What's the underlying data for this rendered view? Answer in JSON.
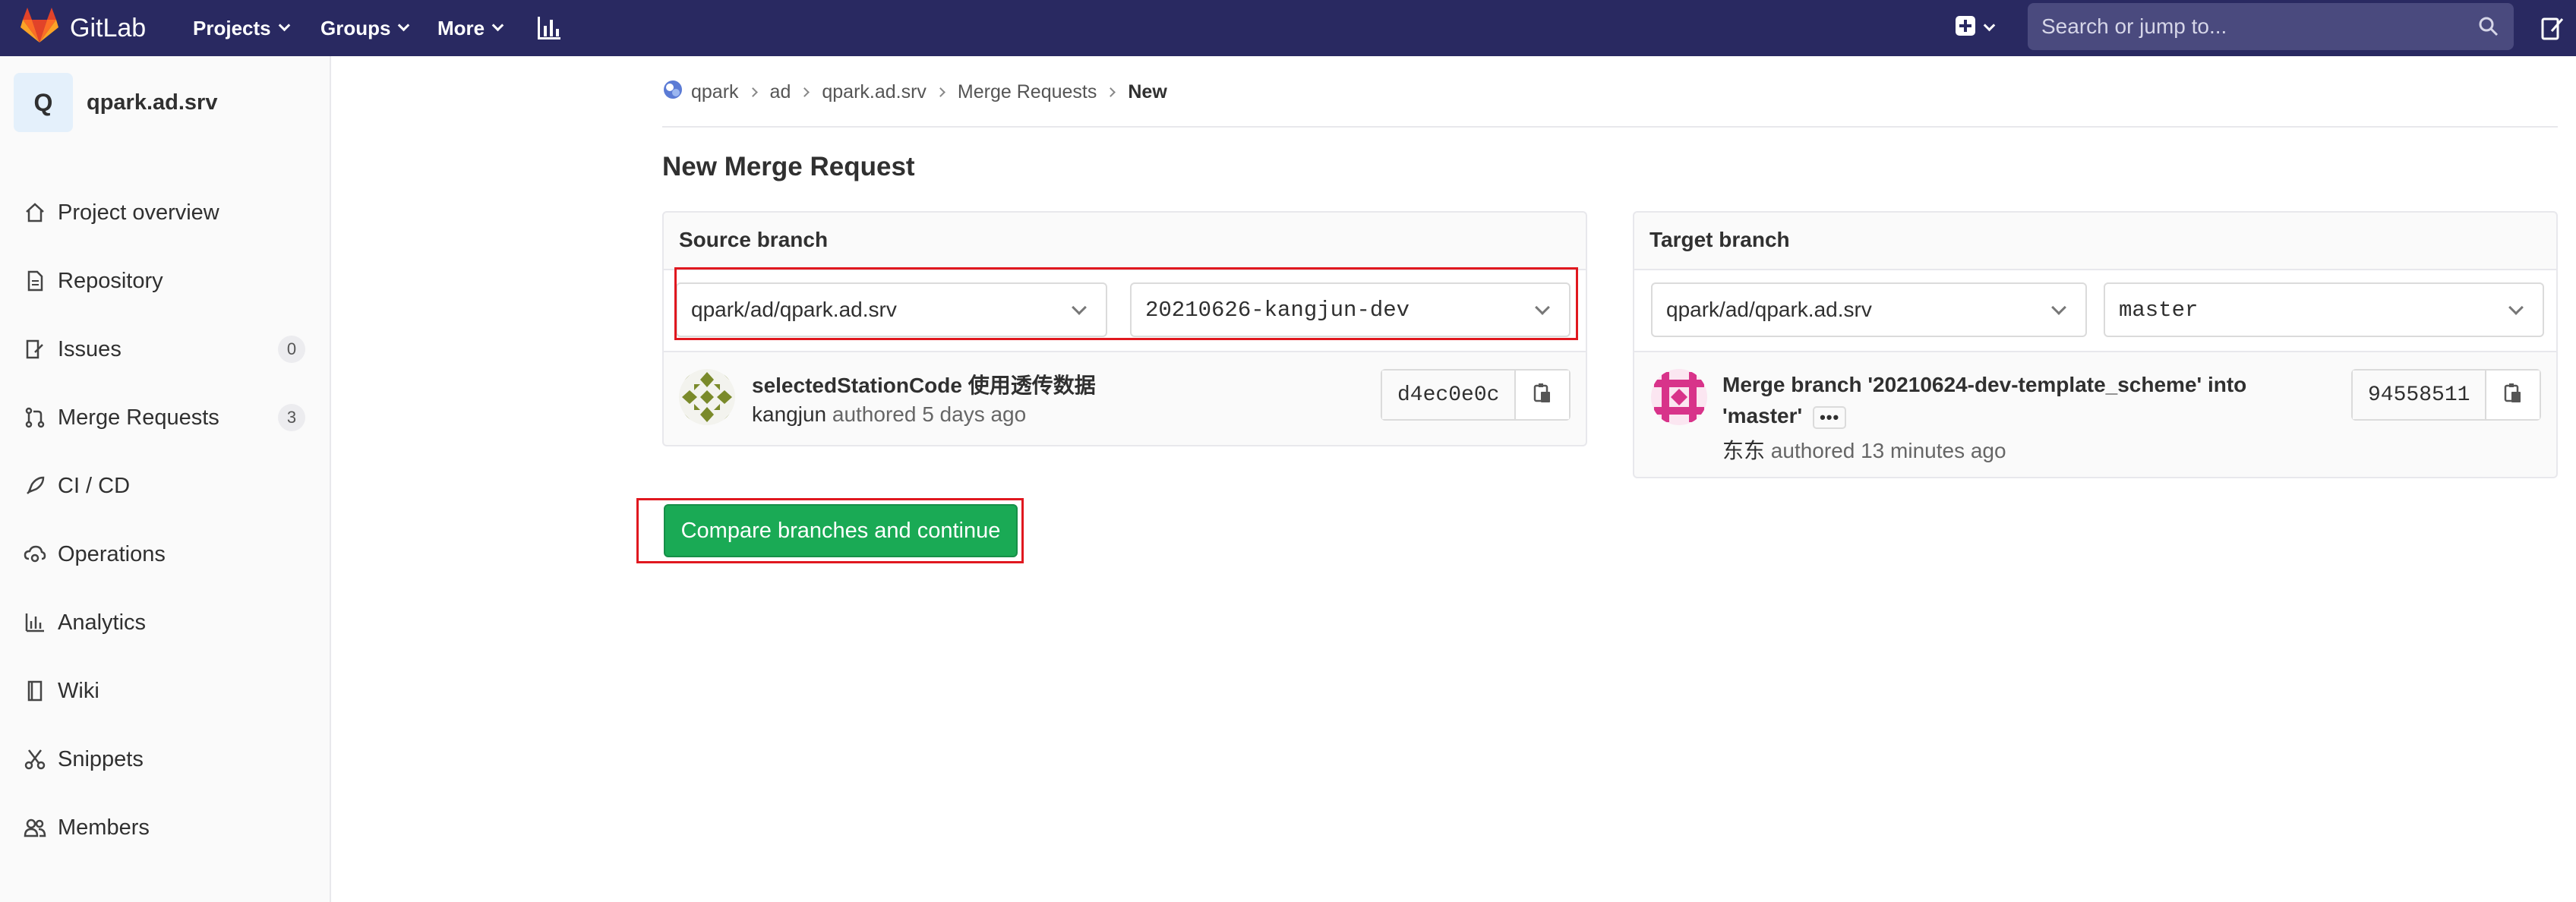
{
  "navbar": {
    "logo_text": "GitLab",
    "projects_label": "Projects",
    "groups_label": "Groups",
    "more_label": "More",
    "search_placeholder": "Search or jump to...",
    "background_color": "#292961"
  },
  "sidebar": {
    "project_initial": "Q",
    "project_name": "qpark.ad.srv",
    "items": [
      {
        "label": "Project overview",
        "icon": "home-icon"
      },
      {
        "label": "Repository",
        "icon": "document-icon"
      },
      {
        "label": "Issues",
        "icon": "issues-icon",
        "badge": "0"
      },
      {
        "label": "Merge Requests",
        "icon": "git-merge-icon",
        "badge": "3"
      },
      {
        "label": "CI / CD",
        "icon": "rocket-icon"
      },
      {
        "label": "Operations",
        "icon": "cloud-gear-icon"
      },
      {
        "label": "Analytics",
        "icon": "chart-icon"
      },
      {
        "label": "Wiki",
        "icon": "book-icon"
      },
      {
        "label": "Snippets",
        "icon": "scissors-icon"
      },
      {
        "label": "Members",
        "icon": "users-icon"
      }
    ]
  },
  "breadcrumb": {
    "items": [
      "qpark",
      "ad",
      "qpark.ad.srv",
      "Merge Requests"
    ],
    "current": "New"
  },
  "page": {
    "title": "New Merge Request",
    "compare_button": "Compare branches and continue",
    "accent_color": "#1aaa55",
    "highlight_color": "#e0181f"
  },
  "source": {
    "title": "Source branch",
    "project": "qpark/ad/qpark.ad.srv",
    "branch": "20210626-kangjun-dev",
    "commit": {
      "title": "selectedStationCode 使用透传数据",
      "author": "kangjun",
      "authored_text": "authored 5 days ago",
      "sha": "d4ec0e0c"
    }
  },
  "target": {
    "title": "Target branch",
    "project": "qpark/ad/qpark.ad.srv",
    "branch": "master",
    "commit": {
      "title_line1": "Merge branch '20210624-dev-template_scheme' into",
      "title_line2": "'master'",
      "ellipsis": "•••",
      "author": "东东",
      "authored_text": "authored 13 minutes ago",
      "sha": "94558511"
    }
  }
}
